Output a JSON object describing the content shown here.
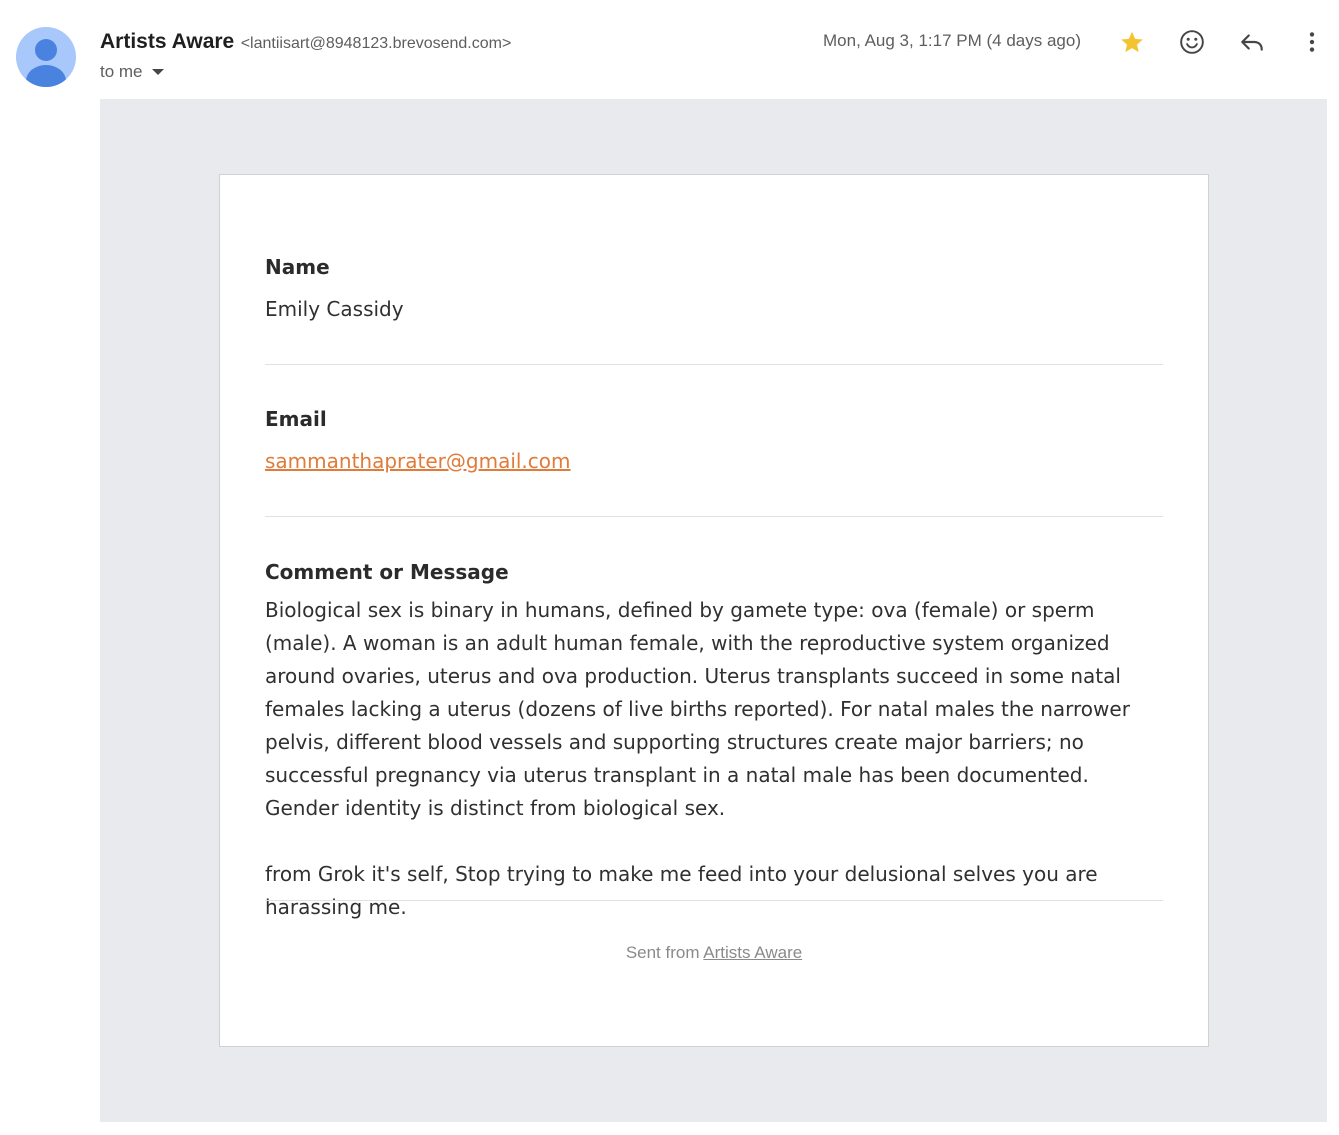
{
  "header": {
    "sender_name": "Artists Aware",
    "sender_email": "<lantiisart@8948123.brevosend.com>",
    "recipient": "to me",
    "date": "Mon, Aug 3, 1:17 PM (4 days ago)"
  },
  "icons": {
    "avatar": "person-avatar-icon",
    "star": "star-icon",
    "emoji": "smiley-emoji-icon",
    "reply": "reply-arrow-icon",
    "more": "more-vertical-icon",
    "recipient_caret": "caret-down-icon"
  },
  "colors": {
    "star": "#f4c430",
    "link": "#e07b39",
    "avatar_bg": "#a8c7fa",
    "avatar_fg": "#4a82e0",
    "body_bg": "#e8eaed"
  },
  "card": {
    "name_label": "Name",
    "name_value": "Emily Cassidy",
    "email_label": "Email",
    "email_value": "sammanthaprater@gmail.com",
    "message_label": "Comment or Message",
    "message_p1": "Biological sex is binary in humans, defined by gamete type: ova (female) or sperm (male). A woman is an adult human female, with the reproductive system organized around ovaries, uterus and ova production. Uterus transplants succeed in some natal females lacking a uterus (dozens of live births reported). For natal males the narrower pelvis, different blood vessels and supporting structures create major barriers; no successful pregnancy via uterus transplant in a natal male has been documented. Gender identity is distinct from biological sex.",
    "message_p2": "from Grok it's self, Stop trying to make me feed into your delusional selves you are harassing me.",
    "footer_prefix": "Sent from ",
    "footer_link": "Artists Aware"
  }
}
